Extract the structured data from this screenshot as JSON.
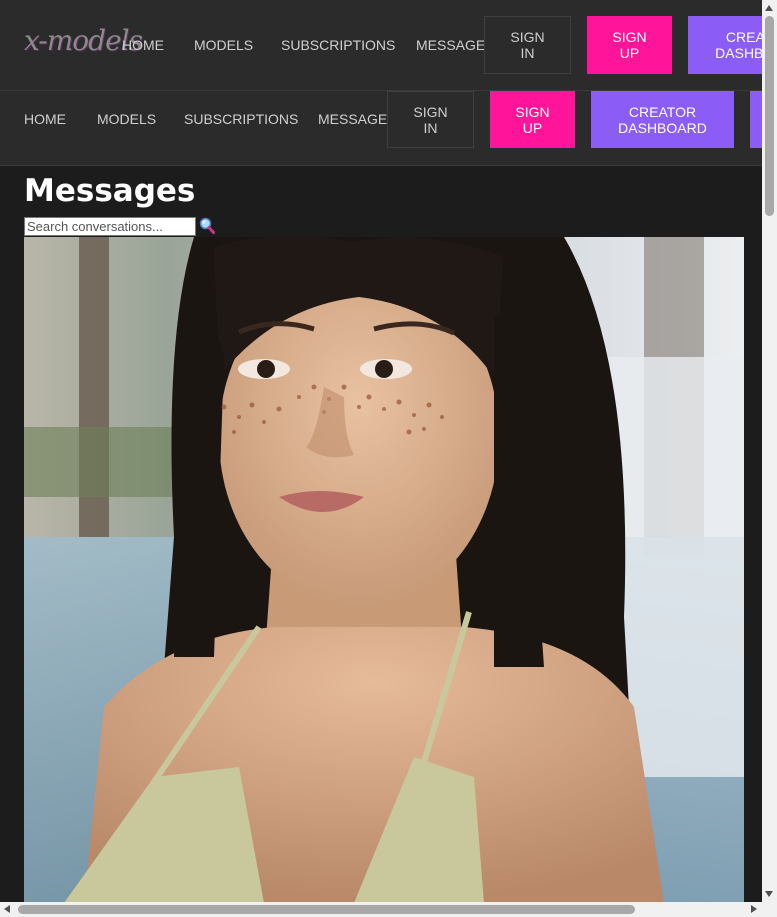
{
  "brand": {
    "logo": "x-models"
  },
  "nav_primary": {
    "links": [
      "HOME",
      "MODELS",
      "SUBSCRIPTIONS",
      "MESSAGES"
    ],
    "sign_in": "SIGN IN",
    "sign_up": "SIGN UP",
    "creator": "CREATOR DASHBOARD"
  },
  "nav_secondary": {
    "links": [
      "HOME",
      "MODELS",
      "SUBSCRIPTIONS",
      "MESSAGES"
    ],
    "sign_in": "SIGN IN",
    "sign_up": "SIGN UP",
    "creator": "CREATOR DASHBOARD"
  },
  "page": {
    "title": "Messages",
    "search_placeholder": "Search conversations..."
  },
  "colors": {
    "background": "#1c1c1c",
    "nav": "#2b2b2b",
    "signup": "#ff149a",
    "creator": "#8b5cf6"
  }
}
